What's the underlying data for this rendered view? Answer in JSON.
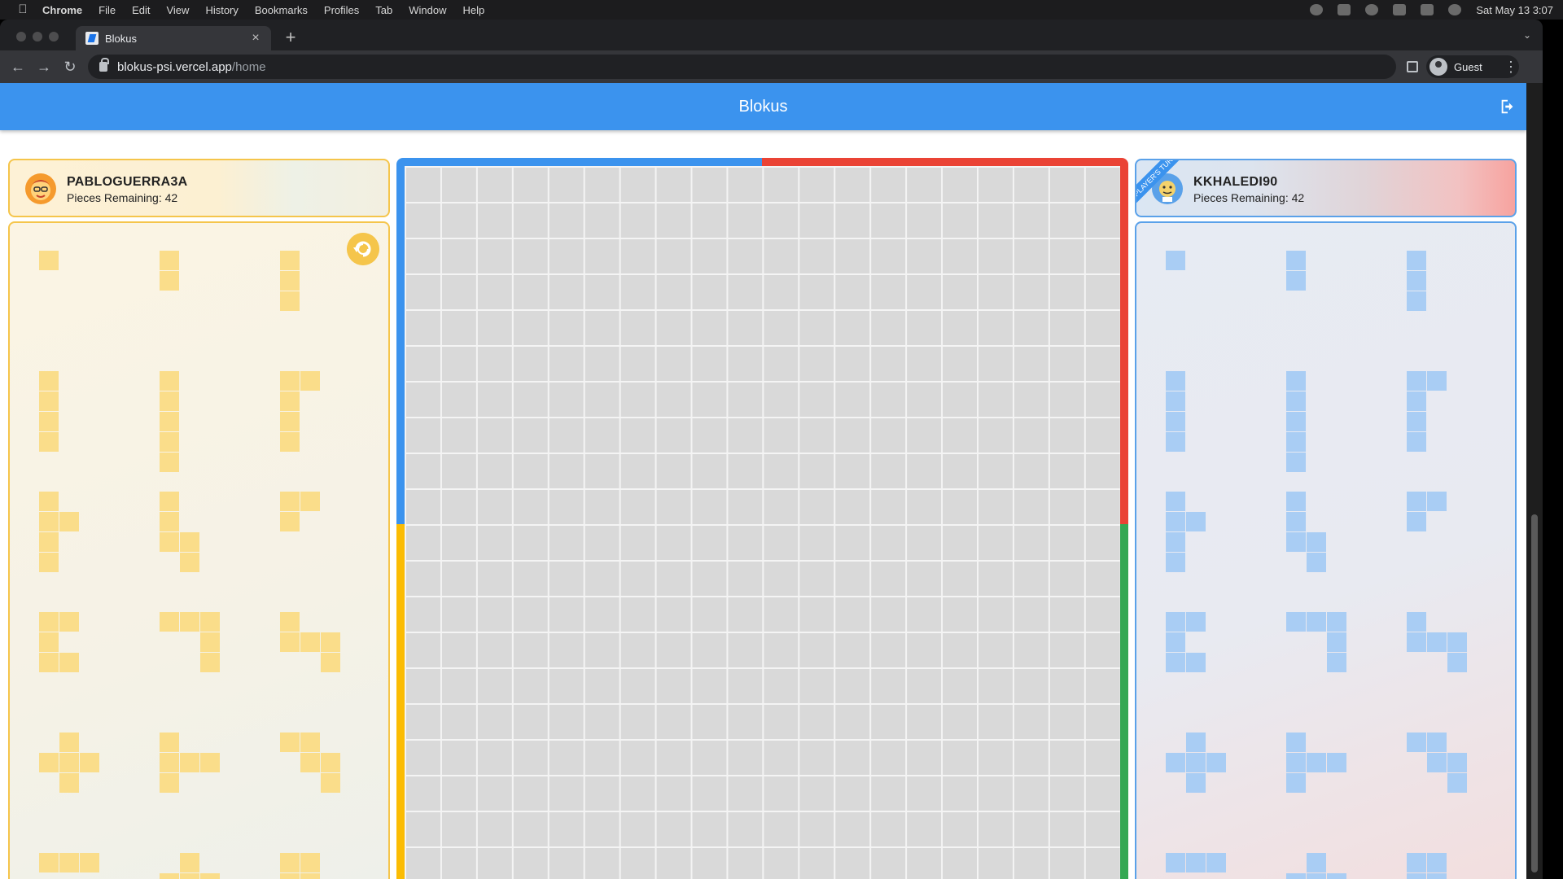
{
  "menubar": {
    "app_name": "Chrome",
    "items": [
      "File",
      "Edit",
      "View",
      "History",
      "Bookmarks",
      "Profiles",
      "Tab",
      "Window",
      "Help"
    ],
    "clock": "Sat May 13  3:07"
  },
  "browser": {
    "tab_title": "Blokus",
    "url_host": "blokus-psi.vercel.app",
    "url_path": "/home",
    "profile_label": "Guest"
  },
  "app": {
    "title": "Blokus",
    "colors": {
      "blue": "#3b93ee",
      "red": "#ea4335",
      "yellow": "#fbbc04",
      "green": "#34a853"
    }
  },
  "players": {
    "left": {
      "name": "PABLOGUERRA3A",
      "pieces_remaining": "Pieces Remaining: 42",
      "color": "#f5c54b"
    },
    "right": {
      "name": "KKHALEDI90",
      "pieces_remaining": "Pieces Remaining: 42",
      "turn_badge": "PLAYER'S TURN",
      "color": "#5aa1e9"
    }
  },
  "board": {
    "size": 20
  },
  "pieces": [
    [
      [
        0,
        0
      ]
    ],
    [
      [
        0,
        0
      ],
      [
        0,
        1
      ]
    ],
    [
      [
        0,
        0
      ],
      [
        0,
        1
      ],
      [
        0,
        2
      ]
    ],
    [
      [
        0,
        0
      ],
      [
        0,
        1
      ],
      [
        0,
        2
      ],
      [
        0,
        3
      ]
    ],
    [
      [
        0,
        0
      ],
      [
        0,
        1
      ],
      [
        0,
        2
      ],
      [
        0,
        3
      ],
      [
        0,
        4
      ]
    ],
    [
      [
        0,
        0
      ],
      [
        1,
        0
      ],
      [
        0,
        1
      ],
      [
        0,
        2
      ],
      [
        0,
        3
      ]
    ],
    [
      [
        0,
        0
      ],
      [
        0,
        1
      ],
      [
        1,
        1
      ],
      [
        0,
        2
      ],
      [
        0,
        3
      ]
    ],
    [
      [
        0,
        0
      ],
      [
        0,
        1
      ],
      [
        0,
        2
      ],
      [
        1,
        2
      ],
      [
        1,
        3
      ]
    ],
    [
      [
        0,
        0
      ],
      [
        1,
        0
      ],
      [
        0,
        1
      ]
    ],
    [
      [
        0,
        0
      ],
      [
        1,
        0
      ],
      [
        0,
        1
      ],
      [
        0,
        2
      ],
      [
        1,
        2
      ]
    ],
    [
      [
        0,
        0
      ],
      [
        1,
        0
      ],
      [
        2,
        0
      ],
      [
        2,
        1
      ],
      [
        2,
        2
      ]
    ],
    [
      [
        0,
        0
      ],
      [
        0,
        1
      ],
      [
        1,
        1
      ],
      [
        2,
        1
      ],
      [
        2,
        2
      ]
    ],
    [
      [
        1,
        0
      ],
      [
        0,
        1
      ],
      [
        1,
        1
      ],
      [
        2,
        1
      ],
      [
        1,
        2
      ]
    ],
    [
      [
        0,
        0
      ],
      [
        0,
        1
      ],
      [
        1,
        1
      ],
      [
        2,
        1
      ],
      [
        0,
        2
      ]
    ],
    [
      [
        0,
        0
      ],
      [
        1,
        0
      ],
      [
        1,
        1
      ],
      [
        2,
        1
      ],
      [
        2,
        2
      ]
    ],
    [
      [
        0,
        0
      ],
      [
        1,
        0
      ],
      [
        2,
        0
      ]
    ],
    [
      [
        1,
        0
      ],
      [
        0,
        1
      ],
      [
        1,
        1
      ],
      [
        2,
        1
      ]
    ],
    [
      [
        0,
        0
      ],
      [
        1,
        0
      ],
      [
        0,
        1
      ],
      [
        1,
        1
      ]
    ]
  ]
}
